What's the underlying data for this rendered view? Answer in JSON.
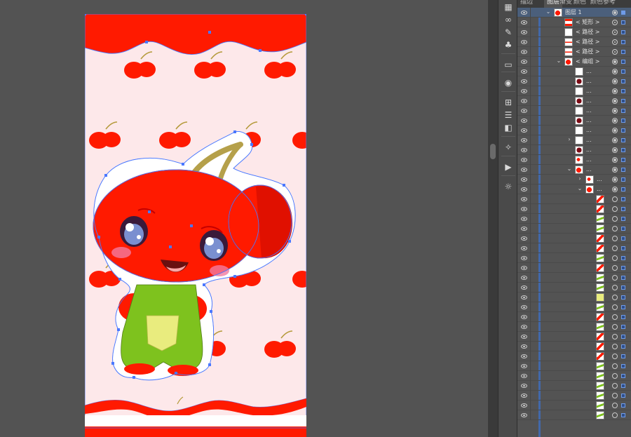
{
  "panel": {
    "tabs": [
      "描边",
      "图层",
      "渐变",
      "颜色",
      "颜色参考"
    ],
    "active_tab": "图层"
  },
  "layers": [
    {
      "name": "图层 1",
      "level": 0,
      "arrow": "open",
      "thumb": "red-cherry",
      "selected": true,
      "target": "filled",
      "selbox": "solid"
    },
    {
      "name": "< 矩形 >",
      "level": 1,
      "arrow": "",
      "thumb": "red-band",
      "target": "double",
      "selbox": "outline"
    },
    {
      "name": "< 路径 >",
      "level": 1,
      "arrow": "",
      "thumb": "blank",
      "target": "double",
      "selbox": "outline"
    },
    {
      "name": "< 路径 >",
      "level": 1,
      "arrow": "",
      "thumb": "red-line",
      "target": "double",
      "selbox": "outline"
    },
    {
      "name": "< 路径 >",
      "level": 1,
      "arrow": "",
      "thumb": "red-line",
      "target": "double",
      "selbox": "outline"
    },
    {
      "name": "< 编组 >",
      "level": 1,
      "arrow": "open",
      "thumb": "red-cherry",
      "target": "filled",
      "selbox": "outline"
    },
    {
      "name": "...",
      "level": 2,
      "arrow": "",
      "thumb": "blank",
      "target": "filled",
      "selbox": "outline"
    },
    {
      "name": "...",
      "level": 2,
      "arrow": "",
      "thumb": "dark-red",
      "target": "filled",
      "selbox": "outline"
    },
    {
      "name": "...",
      "level": 2,
      "arrow": "",
      "thumb": "blank",
      "target": "filled",
      "selbox": "outline"
    },
    {
      "name": "...",
      "level": 2,
      "arrow": "",
      "thumb": "dark-red",
      "target": "filled",
      "selbox": "outline"
    },
    {
      "name": "...",
      "level": 2,
      "arrow": "",
      "thumb": "blank",
      "target": "filled",
      "selbox": "outline"
    },
    {
      "name": "...",
      "level": 2,
      "arrow": "",
      "thumb": "dark-red",
      "target": "filled",
      "selbox": "outline"
    },
    {
      "name": "...",
      "level": 2,
      "arrow": "",
      "thumb": "blank",
      "target": "filled",
      "selbox": "outline"
    },
    {
      "name": "...",
      "level": 2,
      "arrow": "closed",
      "thumb": "blank",
      "target": "filled",
      "selbox": "outline"
    },
    {
      "name": "...",
      "level": 2,
      "arrow": "",
      "thumb": "dark-red",
      "target": "filled",
      "selbox": "outline"
    },
    {
      "name": "...",
      "level": 2,
      "arrow": "",
      "thumb": "small-red",
      "target": "filled",
      "selbox": "outline"
    },
    {
      "name": "...",
      "level": 2,
      "arrow": "open",
      "thumb": "red-cherry",
      "target": "filled",
      "selbox": "outline"
    },
    {
      "name": "...",
      "level": 3,
      "arrow": "closed",
      "thumb": "small-red",
      "target": "filled",
      "selbox": "outline"
    },
    {
      "name": "...",
      "level": 3,
      "arrow": "open",
      "thumb": "red-cherry",
      "target": "filled",
      "selbox": "outline"
    },
    {
      "name": "",
      "level": 4,
      "arrow": "",
      "thumb": "red-stroke",
      "target": "empty",
      "selbox": "outline"
    },
    {
      "name": "",
      "level": 4,
      "arrow": "",
      "thumb": "red-stroke",
      "target": "empty",
      "selbox": "outline"
    },
    {
      "name": "",
      "level": 4,
      "arrow": "",
      "thumb": "green-stroke",
      "target": "empty",
      "selbox": "outline"
    },
    {
      "name": "",
      "level": 4,
      "arrow": "",
      "thumb": "green-stroke",
      "target": "empty",
      "selbox": "outline"
    },
    {
      "name": "",
      "level": 4,
      "arrow": "",
      "thumb": "red-stroke",
      "target": "empty",
      "selbox": "outline"
    },
    {
      "name": "",
      "level": 4,
      "arrow": "",
      "thumb": "red-stroke",
      "target": "empty",
      "selbox": "outline"
    },
    {
      "name": "",
      "level": 4,
      "arrow": "",
      "thumb": "green-stroke",
      "target": "empty",
      "selbox": "outline"
    },
    {
      "name": "",
      "level": 4,
      "arrow": "",
      "thumb": "red-stroke",
      "target": "empty",
      "selbox": "outline"
    },
    {
      "name": "",
      "level": 4,
      "arrow": "",
      "thumb": "green-stroke",
      "target": "empty",
      "selbox": "outline"
    },
    {
      "name": "",
      "level": 4,
      "arrow": "",
      "thumb": "green-stroke",
      "target": "empty",
      "selbox": "outline"
    },
    {
      "name": "",
      "level": 4,
      "arrow": "",
      "thumb": "yellow-fill",
      "target": "empty",
      "selbox": "outline"
    },
    {
      "name": "",
      "level": 4,
      "arrow": "",
      "thumb": "green-stroke",
      "target": "empty",
      "selbox": "outline"
    },
    {
      "name": "",
      "level": 4,
      "arrow": "",
      "thumb": "red-stroke",
      "target": "empty",
      "selbox": "outline"
    },
    {
      "name": "",
      "level": 4,
      "arrow": "",
      "thumb": "green-stroke",
      "target": "empty",
      "selbox": "outline"
    },
    {
      "name": "",
      "level": 4,
      "arrow": "",
      "thumb": "red-stroke",
      "target": "empty",
      "selbox": "outline"
    },
    {
      "name": "",
      "level": 4,
      "arrow": "",
      "thumb": "red-stroke",
      "target": "empty",
      "selbox": "outline"
    },
    {
      "name": "",
      "level": 4,
      "arrow": "",
      "thumb": "red-stroke",
      "target": "empty",
      "selbox": "outline"
    },
    {
      "name": "",
      "level": 4,
      "arrow": "",
      "thumb": "green-stroke",
      "target": "empty",
      "selbox": "outline"
    },
    {
      "name": "",
      "level": 4,
      "arrow": "",
      "thumb": "green-stroke",
      "target": "empty",
      "selbox": "outline"
    },
    {
      "name": "",
      "level": 4,
      "arrow": "",
      "thumb": "green-stroke",
      "target": "empty",
      "selbox": "outline"
    },
    {
      "name": "",
      "level": 4,
      "arrow": "",
      "thumb": "green-stroke",
      "target": "empty",
      "selbox": "outline"
    },
    {
      "name": "",
      "level": 4,
      "arrow": "",
      "thumb": "green-stroke",
      "target": "empty",
      "selbox": "outline"
    },
    {
      "name": "",
      "level": 4,
      "arrow": "",
      "thumb": "green-stroke",
      "target": "empty",
      "selbox": "outline"
    }
  ],
  "tools": [
    "swatch-libraries-icon",
    "link-icon",
    "brush-icon",
    "club-symbol-icon",
    "gradient-icon",
    "appearance-icon",
    "transform-grid-icon",
    "align-icon",
    "pathfinder-icon",
    "magic-wand-icon",
    "play-action-icon",
    "sun-settings-icon"
  ],
  "colors": {
    "canvas_bg": "#535353",
    "artboard_bg": "#fde8ea",
    "cherry_red": "#ff1a00",
    "overalls_green": "#7ec21e",
    "pocket_yellow": "#e9ec7e",
    "selection_blue": "#4a78ff"
  }
}
